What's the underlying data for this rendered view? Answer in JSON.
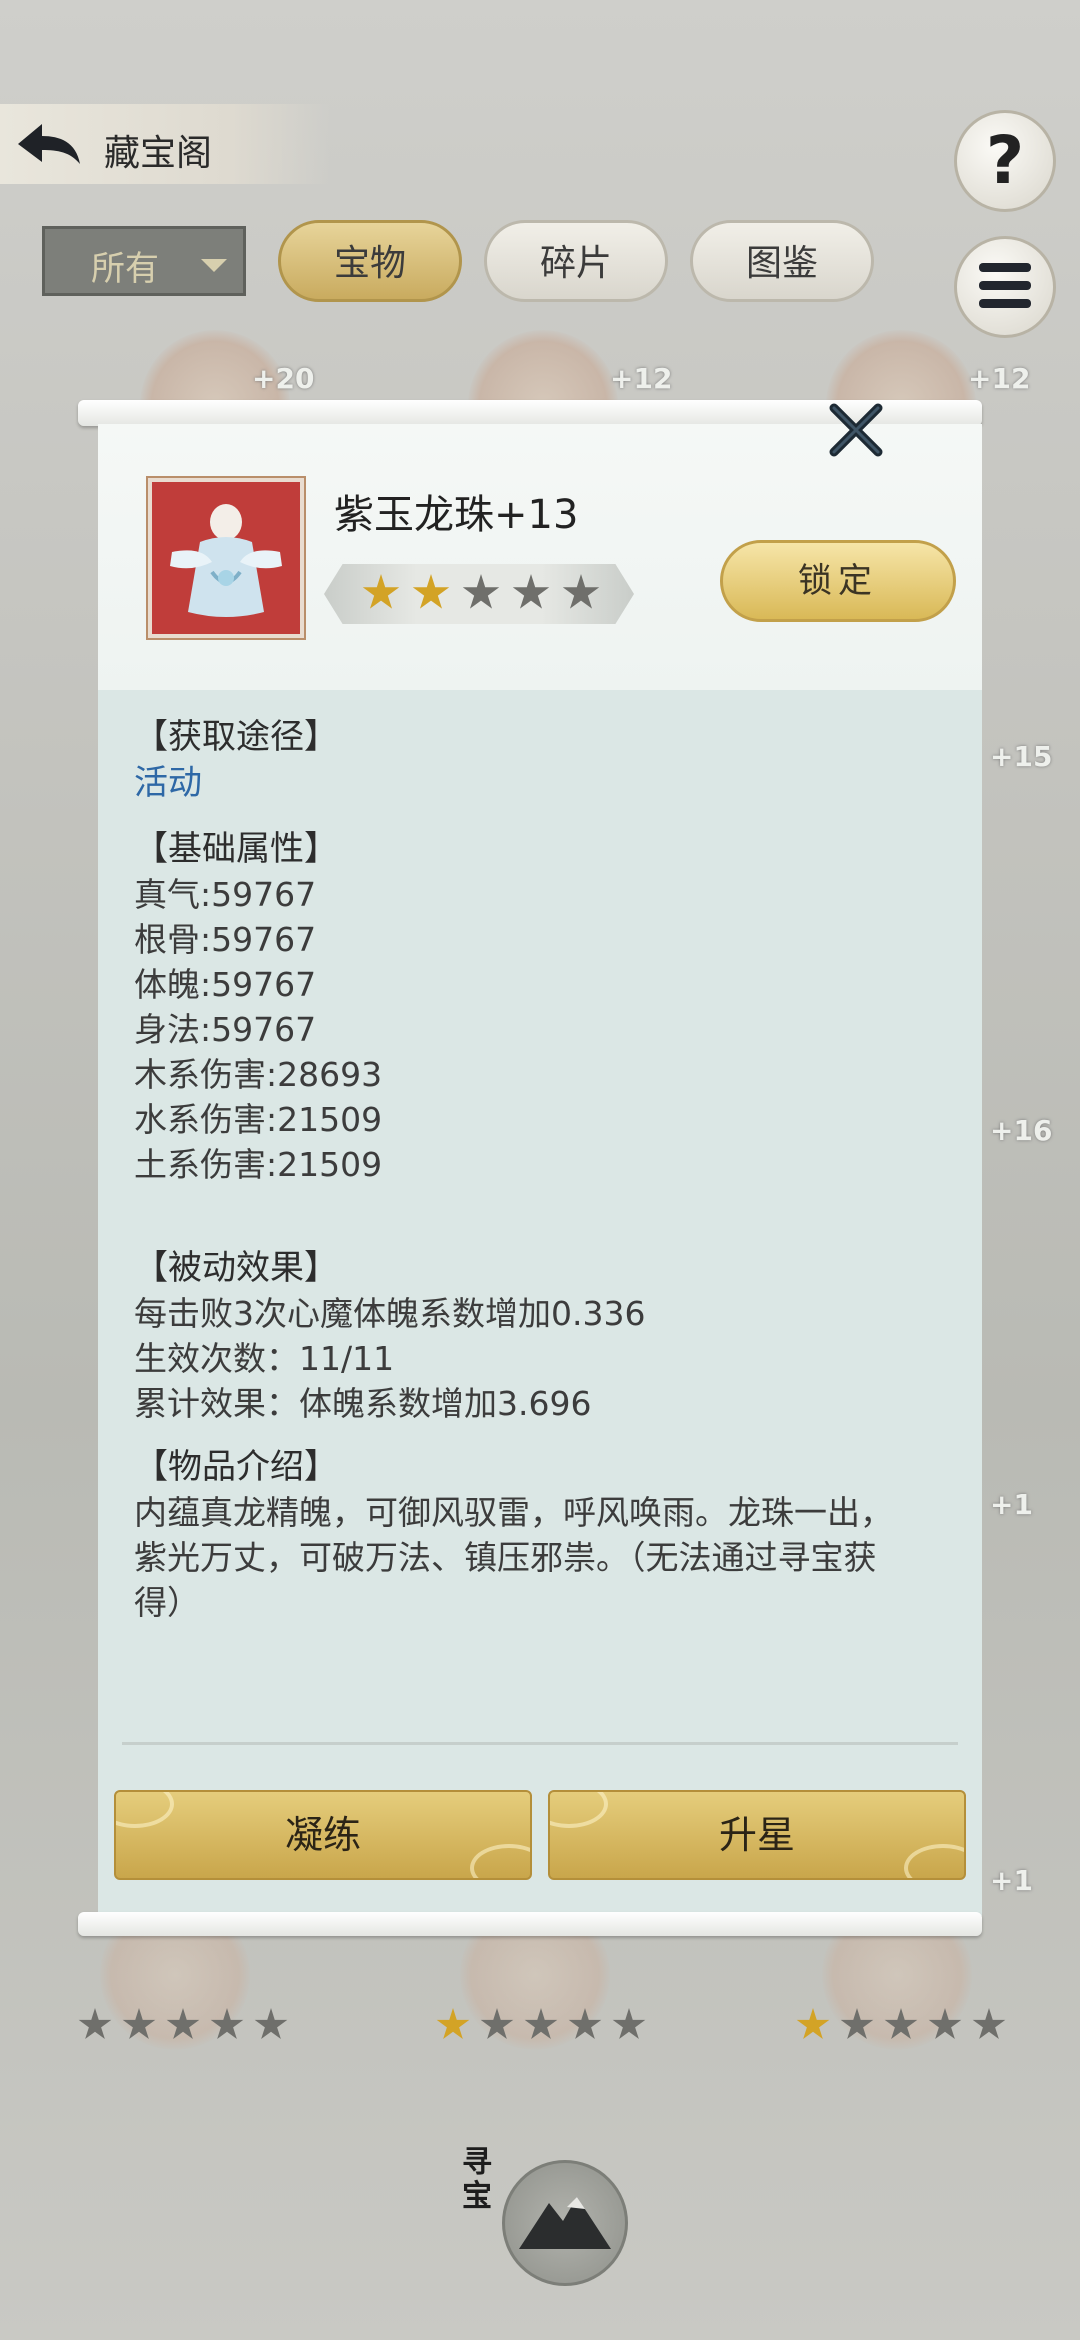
{
  "header": {
    "title": "藏宝阁"
  },
  "filter": {
    "selected": "所有"
  },
  "tabs": [
    {
      "label": "宝物",
      "active": true
    },
    {
      "label": "碎片",
      "active": false
    },
    {
      "label": "图鉴",
      "active": false
    }
  ],
  "grid_badges": [
    "+20",
    "+12",
    "+12",
    "+15",
    "+16",
    "+1",
    "+1"
  ],
  "bottom_stars": [
    {
      "filled": 0,
      "total": 5
    },
    {
      "filled": 1,
      "total": 5
    },
    {
      "filled": 1,
      "total": 5
    }
  ],
  "seek_button": {
    "label": "寻宝"
  },
  "modal": {
    "title": "紫玉龙珠+13",
    "stars": {
      "filled": 2,
      "total": 5
    },
    "lock_label": "锁定",
    "sections": {
      "source": {
        "title": "【获取途径】",
        "link": "活动"
      },
      "base": {
        "title": "【基础属性】",
        "stats": [
          "真气:59767",
          "根骨:59767",
          "体魄:59767",
          "身法:59767",
          "木系伤害:28693",
          "水系伤害:21509",
          "土系伤害:21509"
        ]
      },
      "passive": {
        "title": "【被动效果】",
        "lines": [
          "每击败3次心魔体魄系数增加0.336",
          "生效次数：11/11",
          "累计效果：体魄系数增加3.696"
        ]
      },
      "intro": {
        "title": "【物品介绍】",
        "text": "内蕴真龙精魄，可御风驭雷，呼风唤雨。龙珠一出，紫光万丈，可破万法、镇压邪祟。（无法通过寻宝获得）"
      }
    },
    "buttons": {
      "refine": "凝练",
      "upgrade_star": "升星"
    }
  },
  "colors": {
    "accent_gold": "#d9b957",
    "link_blue": "#2e68a6",
    "panel_bg": "#dbe7e5"
  }
}
